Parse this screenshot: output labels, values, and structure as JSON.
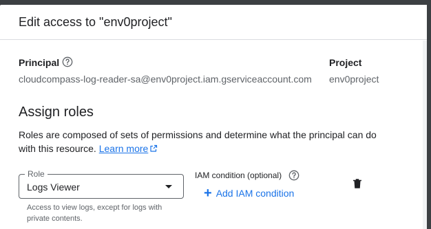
{
  "dialog": {
    "title": "Edit access to \"env0project\""
  },
  "principal": {
    "label": "Principal",
    "value": "cloudcompass-log-reader-sa@env0project.iam.gserviceaccount.com"
  },
  "project": {
    "label": "Project",
    "value": "env0project"
  },
  "assign_roles": {
    "title": "Assign roles",
    "description": "Roles are composed of sets of permissions and determine what the principal can do with this resource.",
    "learn_more": "Learn more"
  },
  "role": {
    "legend": "Role",
    "selected": "Logs Viewer",
    "hint": "Access to view logs, except for logs with private contents."
  },
  "iam_condition": {
    "label": "IAM condition (optional)",
    "add_label": "Add IAM condition"
  },
  "colors": {
    "accent": "#1a73e8",
    "text": "#202124",
    "muted": "#5f6368"
  }
}
